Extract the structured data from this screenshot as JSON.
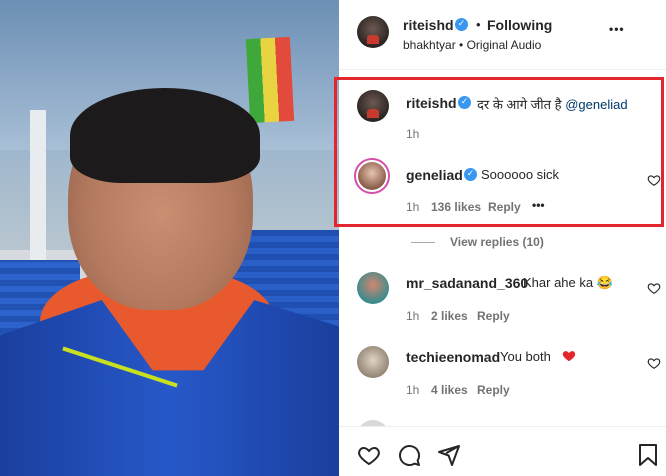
{
  "post": {
    "username": "riteishd",
    "following_label": "Following",
    "separator": "•",
    "audio": "bhakhtyar • Original Audio",
    "more": "•••"
  },
  "comments": [
    {
      "username": "riteishd",
      "text_prefix": "दर के आगे जीत है ",
      "mention": "@geneliad",
      "time": "1h"
    },
    {
      "username": "geneliad",
      "text": "Soooooo sick",
      "time": "1h",
      "likes": "136 likes",
      "reply": "Reply",
      "more": "•••"
    }
  ],
  "view_replies": "View replies (10)",
  "comments2": [
    {
      "username": "mr_sadanand_360",
      "text": "Khar ahe ka 😂",
      "time": "1h",
      "likes": "2 likes",
      "reply": "Reply"
    },
    {
      "username": "techieenomad",
      "text": "You both",
      "time": "1h",
      "likes": "4 likes",
      "reply": "Reply"
    }
  ],
  "colors": {
    "highlight": "#e4252c",
    "verified": "#3897f0",
    "mention": "#00376b",
    "heart_red": "#e4252c"
  },
  "icons": [
    "like-icon",
    "comment-icon",
    "share-icon",
    "save-icon",
    "more-options-icon",
    "verified-badge-icon"
  ]
}
